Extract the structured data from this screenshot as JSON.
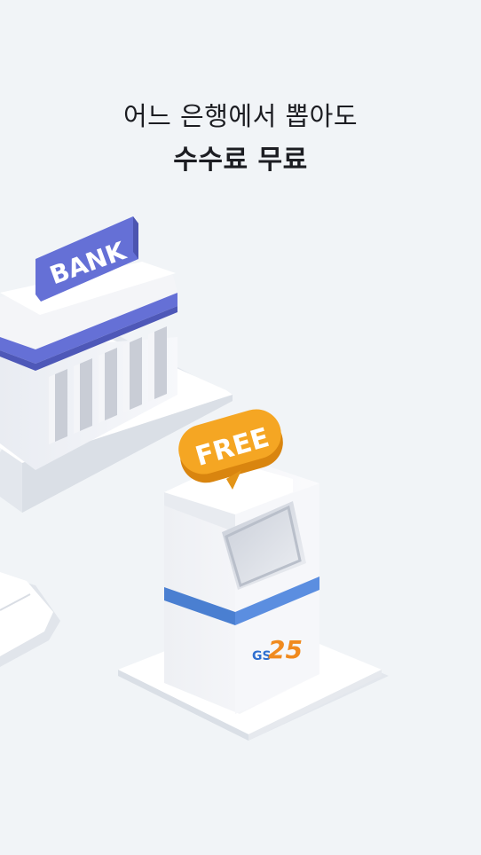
{
  "headline": {
    "line1": "어느 은행에서 뽑아도",
    "line2": "수수료 무료"
  },
  "illustration": {
    "bank_sign": "BANK",
    "free_badge": "FREE",
    "atm_logo_prefix": "GS",
    "atm_logo_number": "25"
  },
  "colors": {
    "background": "#f1f4f7",
    "bank_accent": "#6570d6",
    "badge_orange": "#f5a623",
    "atm_stripe": "#4a7fd1",
    "logo_blue": "#2f6fd0",
    "logo_orange": "#f08a1e"
  }
}
